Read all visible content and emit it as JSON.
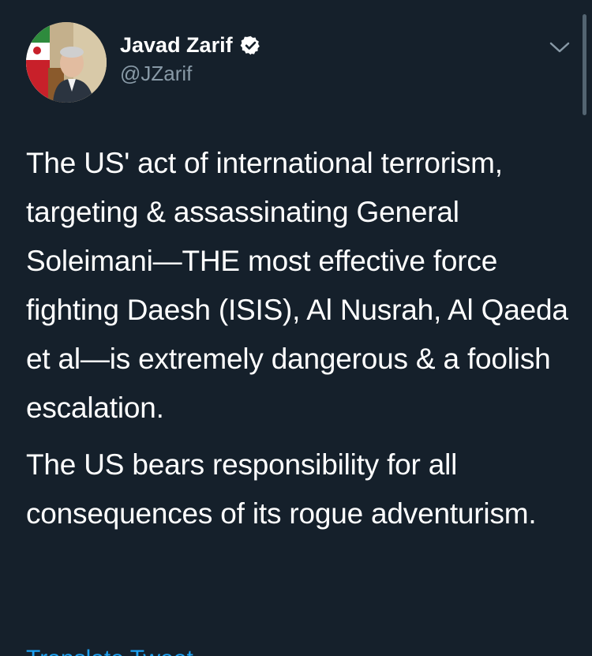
{
  "tweet": {
    "author": {
      "display_name": "Javad Zarif",
      "handle": "@JZarif",
      "verified": true,
      "avatar_icon": "profile-photo"
    },
    "menu_icon": "chevron-down-icon",
    "paragraphs": [
      "The US' act of international terrorism, targeting & assassinating General Soleimani—THE most effective force fighting Daesh (ISIS), Al Nusrah, Al Qaeda et al—is extremely dangerous & a foolish escalation.",
      "The US bears responsibility for all consequences of its rogue adventurism."
    ],
    "translate_label": "Translate Tweet"
  },
  "colors": {
    "background": "#15202b",
    "text": "#ffffff",
    "secondary_text": "#8899a6",
    "accent": "#1da1f2"
  }
}
